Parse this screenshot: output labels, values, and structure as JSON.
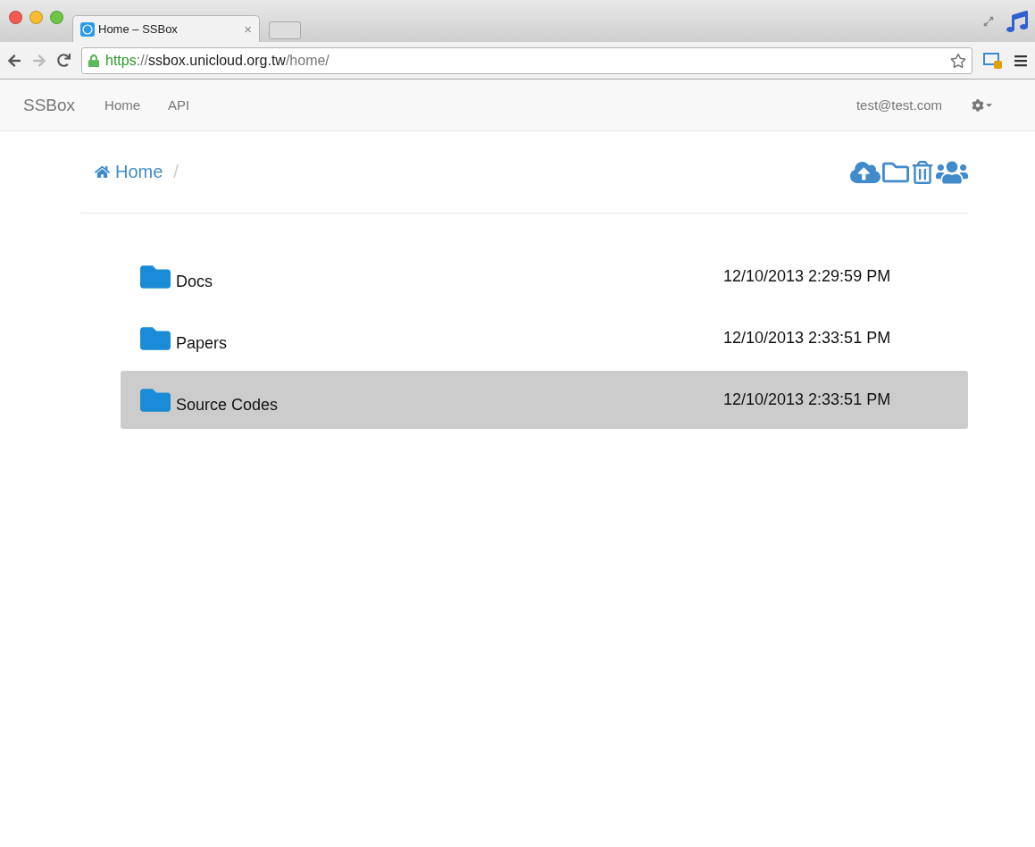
{
  "browser": {
    "tab_title": "Home – SSBox",
    "tab_close": "×",
    "url": {
      "scheme": "https",
      "separator": "://",
      "host": "ssbox.unicloud.org.tw",
      "path": "/home/"
    }
  },
  "navbar": {
    "brand": "SSBox",
    "items": [
      {
        "label": "Home"
      },
      {
        "label": "API"
      }
    ],
    "user": "test@test.com"
  },
  "breadcrumb": {
    "items": [
      {
        "label": "Home"
      }
    ],
    "divider": "/"
  },
  "files": [
    {
      "name": "Docs",
      "modified": "12/10/2013 2:29:59 PM",
      "selected": false
    },
    {
      "name": "Papers",
      "modified": "12/10/2013 2:33:51 PM",
      "selected": false
    },
    {
      "name": "Source Codes",
      "modified": "12/10/2013 2:33:51 PM",
      "selected": true
    }
  ]
}
